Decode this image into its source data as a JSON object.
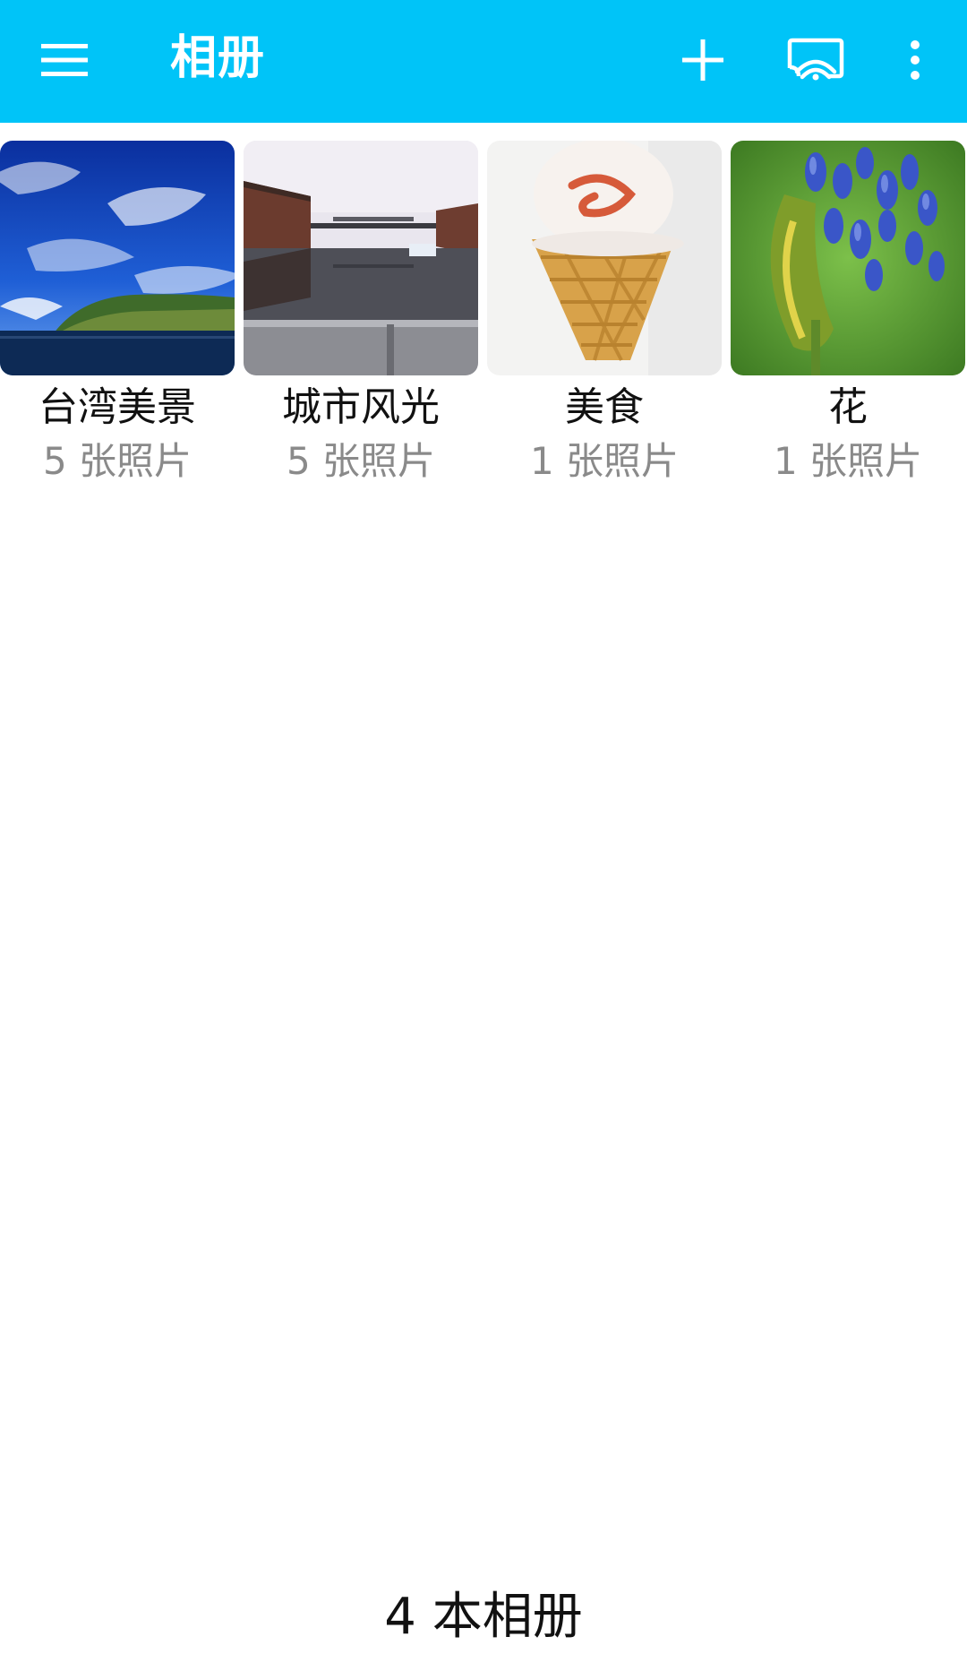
{
  "app_bar": {
    "title": "相册",
    "background_color": "#00C4F8",
    "icons": {
      "menu": "hamburger-menu-icon",
      "add": "plus-icon",
      "cast": "cast-screen-icon",
      "more": "more-vertical-icon"
    }
  },
  "albums": [
    {
      "name": "台湾美景",
      "count": "5 张照片",
      "thumbnail": "coastline-under-blue-sky"
    },
    {
      "name": "城市风光",
      "count": "5 张照片",
      "thumbnail": "harbor-canal-with-brick-buildings"
    },
    {
      "name": "美食",
      "count": "1 张照片",
      "thumbnail": "ice-cream-cone"
    },
    {
      "name": "花",
      "count": "1 张照片",
      "thumbnail": "blue-agapanthus-flower"
    }
  ],
  "footer": {
    "summary": "4 本相册"
  }
}
